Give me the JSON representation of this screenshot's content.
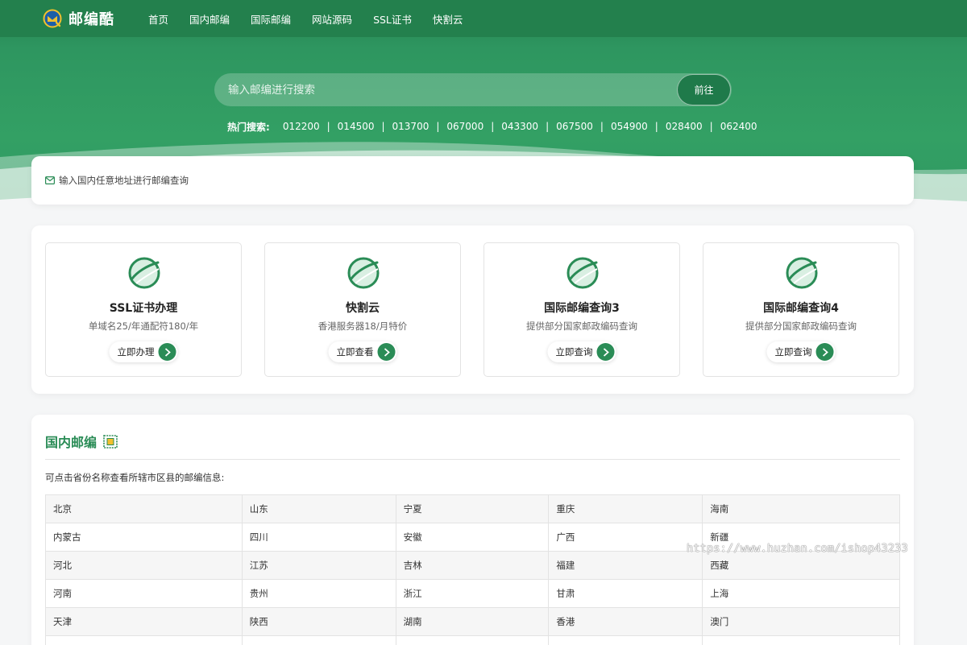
{
  "brand": {
    "name": "邮编酷"
  },
  "nav": [
    {
      "label": "首页"
    },
    {
      "label": "国内邮编"
    },
    {
      "label": "国际邮编"
    },
    {
      "label": "网站源码"
    },
    {
      "label": "SSL证书"
    },
    {
      "label": "快割云"
    }
  ],
  "search": {
    "placeholder": "输入邮编进行搜索",
    "button": "前往"
  },
  "hot": {
    "label": "热门搜索:",
    "items": [
      "012200",
      "014500",
      "013700",
      "067000",
      "043300",
      "067500",
      "054900",
      "028400",
      "062400"
    ]
  },
  "address": {
    "text": "输入国内任意地址进行邮编查询"
  },
  "services": [
    {
      "title": "SSL证书办理",
      "desc": "单域名25/年通配符180/年",
      "button": "立即办理"
    },
    {
      "title": "快割云",
      "desc": "香港服务器18/月特价",
      "button": "立即查看"
    },
    {
      "title": "国际邮编查询3",
      "desc": "提供部分国家邮政编码查询",
      "button": "立即查询"
    },
    {
      "title": "国际邮编查询4",
      "desc": "提供部分国家邮政编码查询",
      "button": "立即查询"
    }
  ],
  "domestic": {
    "title": "国内邮编",
    "note": "可点击省份名称查看所辖市区县的邮编信息:",
    "rows": [
      [
        "北京",
        "山东",
        "宁夏",
        "重庆",
        "海南"
      ],
      [
        "内蒙古",
        "四川",
        "安徽",
        "广西",
        "新疆"
      ],
      [
        "河北",
        "江苏",
        "吉林",
        "福建",
        "西藏"
      ],
      [
        "河南",
        "贵州",
        "浙江",
        "甘肃",
        "上海"
      ],
      [
        "天津",
        "陕西",
        "湖南",
        "香港",
        "澳门"
      ],
      [
        "",
        "",
        "",
        "",
        ""
      ]
    ]
  },
  "watermark": "https://www.huzhan.com/ishop43233",
  "colors": {
    "primary": "#2a8c56",
    "nav": "#23804d",
    "hero": "#319a62"
  }
}
